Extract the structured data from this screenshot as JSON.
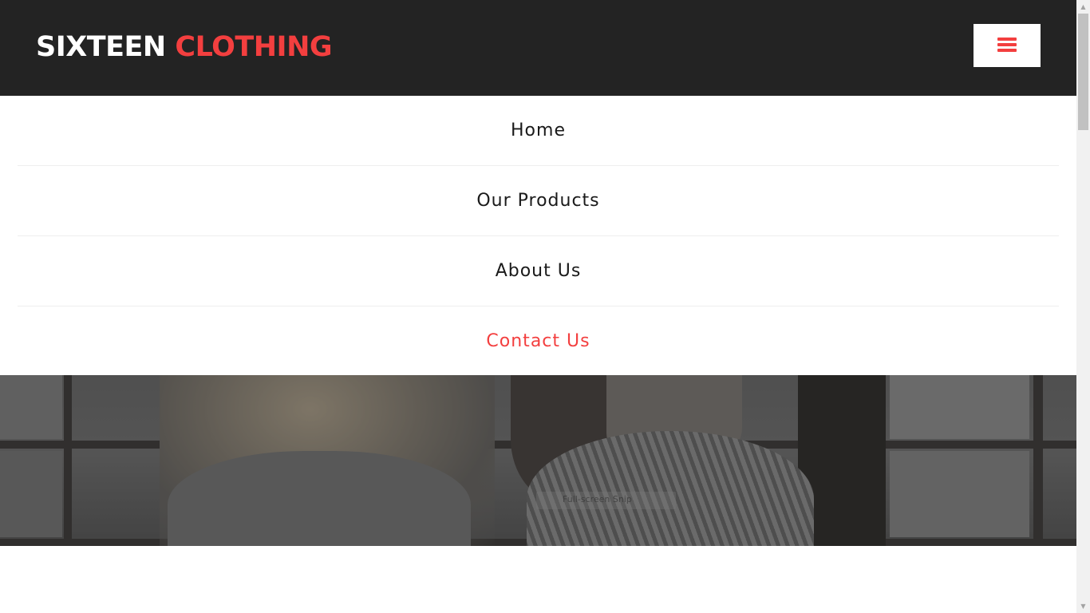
{
  "header": {
    "logo_part1": "SIXTEEN",
    "logo_part2": "CLOTHING",
    "menu_toggle_icon": "hamburger-icon"
  },
  "nav": {
    "items": [
      {
        "label": "Home",
        "active": false
      },
      {
        "label": "Our Products",
        "active": false
      },
      {
        "label": "About Us",
        "active": false
      },
      {
        "label": "Contact Us",
        "active": true
      }
    ]
  },
  "hero": {
    "overlay_tooltip": "Full-screen Snip"
  },
  "colors": {
    "header_bg": "#232323",
    "accent": "#f33f3f",
    "nav_text": "#1a1a1a"
  }
}
